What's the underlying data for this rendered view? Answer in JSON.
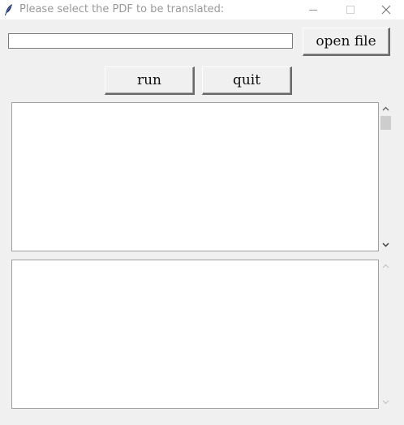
{
  "window": {
    "title": "Please select the PDF to be translated:"
  },
  "icons": {
    "app": "feather-icon",
    "minimize": "minimize-icon",
    "maximize": "maximize-icon",
    "close": "close-icon",
    "scroll_up": "chevron-up-icon",
    "scroll_down": "chevron-down-icon"
  },
  "file_entry": {
    "value": ""
  },
  "buttons": {
    "open_file": "open file",
    "run": "run",
    "quit": "quit"
  },
  "output_top": {
    "text": "",
    "scrollbar_enabled": true
  },
  "output_bottom": {
    "text": "",
    "scrollbar_enabled": false
  }
}
